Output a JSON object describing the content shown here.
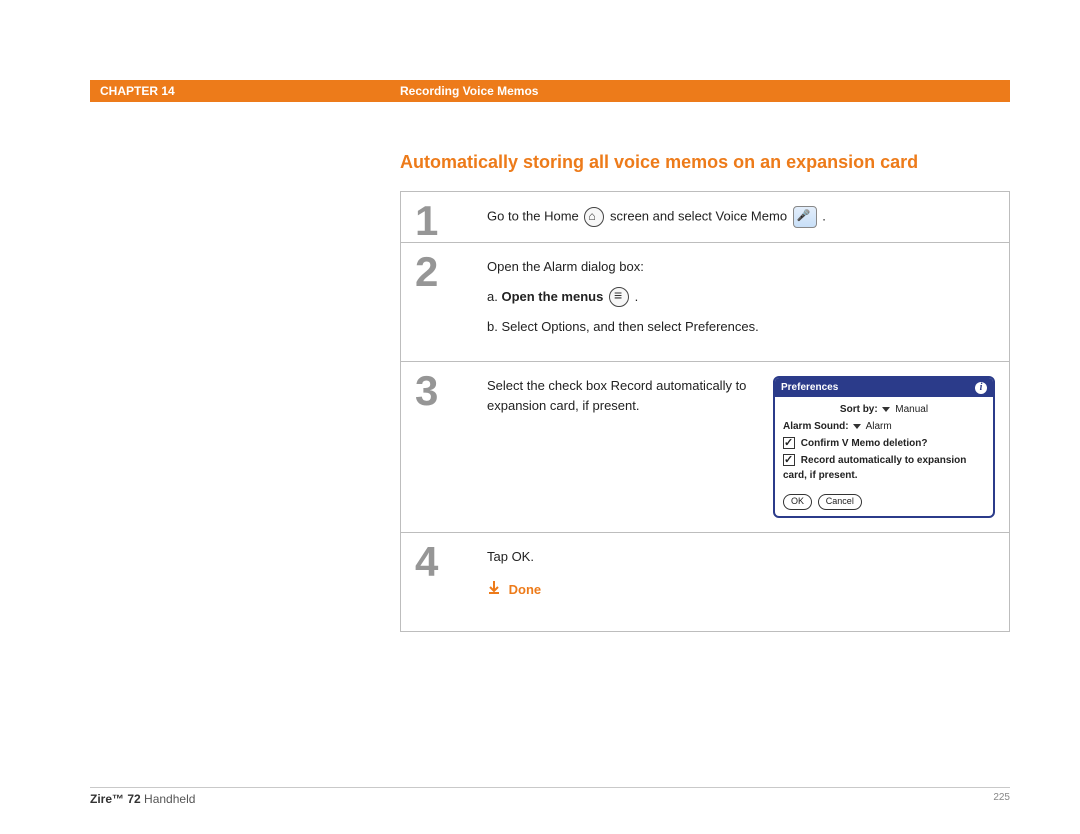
{
  "header": {
    "chapter": "CHAPTER 14",
    "section": "Recording Voice Memos"
  },
  "title": "Automatically storing all voice memos on an expansion card",
  "steps": {
    "s1": {
      "num": "1",
      "text_a": "Go to the Home ",
      "text_b": " screen and select Voice Memo ",
      "text_c": " ."
    },
    "s2": {
      "num": "2",
      "intro": "Open the Alarm dialog box:",
      "a_prefix": "a.  ",
      "a_bold": "Open the menus",
      "a_suffix": " .",
      "b": "b.  Select Options, and then select Preferences."
    },
    "s3": {
      "num": "3",
      "text": "Select the check box Record automatically to expansion card, if present.",
      "pref": {
        "title": "Preferences",
        "sortby_label": "Sort by:",
        "sortby_value": "Manual",
        "alarm_label": "Alarm Sound:",
        "alarm_value": "Alarm",
        "check1": "Confirm V Memo deletion?",
        "check2": "Record automatically to expansion card, if present.",
        "ok": "OK",
        "cancel": "Cancel"
      }
    },
    "s4": {
      "num": "4",
      "text": "Tap OK.",
      "done": "Done"
    }
  },
  "footer": {
    "product_bold": "Zire™ 72",
    "product_rest": " Handheld",
    "page": "225"
  }
}
